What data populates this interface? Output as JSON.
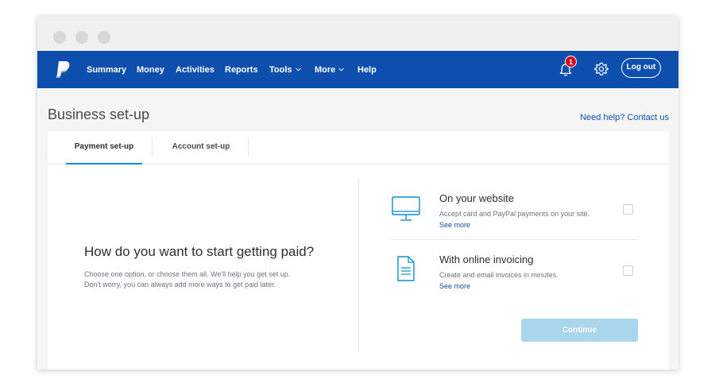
{
  "nav": {
    "items": [
      "Summary",
      "Money",
      "Activities",
      "Reports",
      "Tools",
      "More",
      "Help"
    ],
    "notification_count": "1",
    "logout_label": "Log out"
  },
  "page": {
    "title": "Business set-up",
    "help_link": "Need help? Contact us"
  },
  "tabs": [
    "Payment set-up",
    "Account set-up"
  ],
  "main": {
    "heading": "How do you want to start getting paid?",
    "desc_line1": "Choose one option, or choose them all. We'll help you get set up.",
    "desc_line2": "Don't worry, you can always add more ways to get paid later."
  },
  "options": [
    {
      "title": "On your website",
      "description": "Accept card and PayPal payments on your site.",
      "link": "See more",
      "icon": "monitor-icon",
      "checked": false
    },
    {
      "title": "With online invoicing",
      "description": "Create and email invoices in minutes.",
      "link": "See more",
      "icon": "invoice-document-icon",
      "checked": false
    }
  ],
  "continue_label": "Continue",
  "colors": {
    "navbar": "#0e4fad",
    "accent": "#0d8bd6",
    "link": "#0e4fad",
    "badge": "#d0021b",
    "continue_disabled": "#a9d6ec"
  }
}
